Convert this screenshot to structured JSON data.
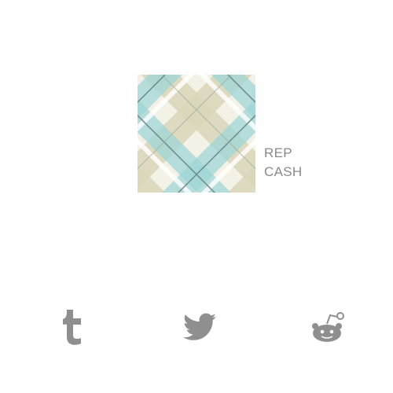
{
  "caption": {
    "line1": "REP",
    "line2": "CASH"
  },
  "share": {
    "items": [
      {
        "icon": "tumblr-icon"
      },
      {
        "icon": "twitter-icon"
      },
      {
        "icon": "reddit-icon"
      }
    ]
  },
  "colors": {
    "icon": "#8f8f8f",
    "text": "#8a8a8a",
    "plaid_teal": "#9fd6d7",
    "plaid_khaki": "#d9d6b8",
    "plaid_line": "#6f8a88",
    "background": "#ffffff"
  }
}
